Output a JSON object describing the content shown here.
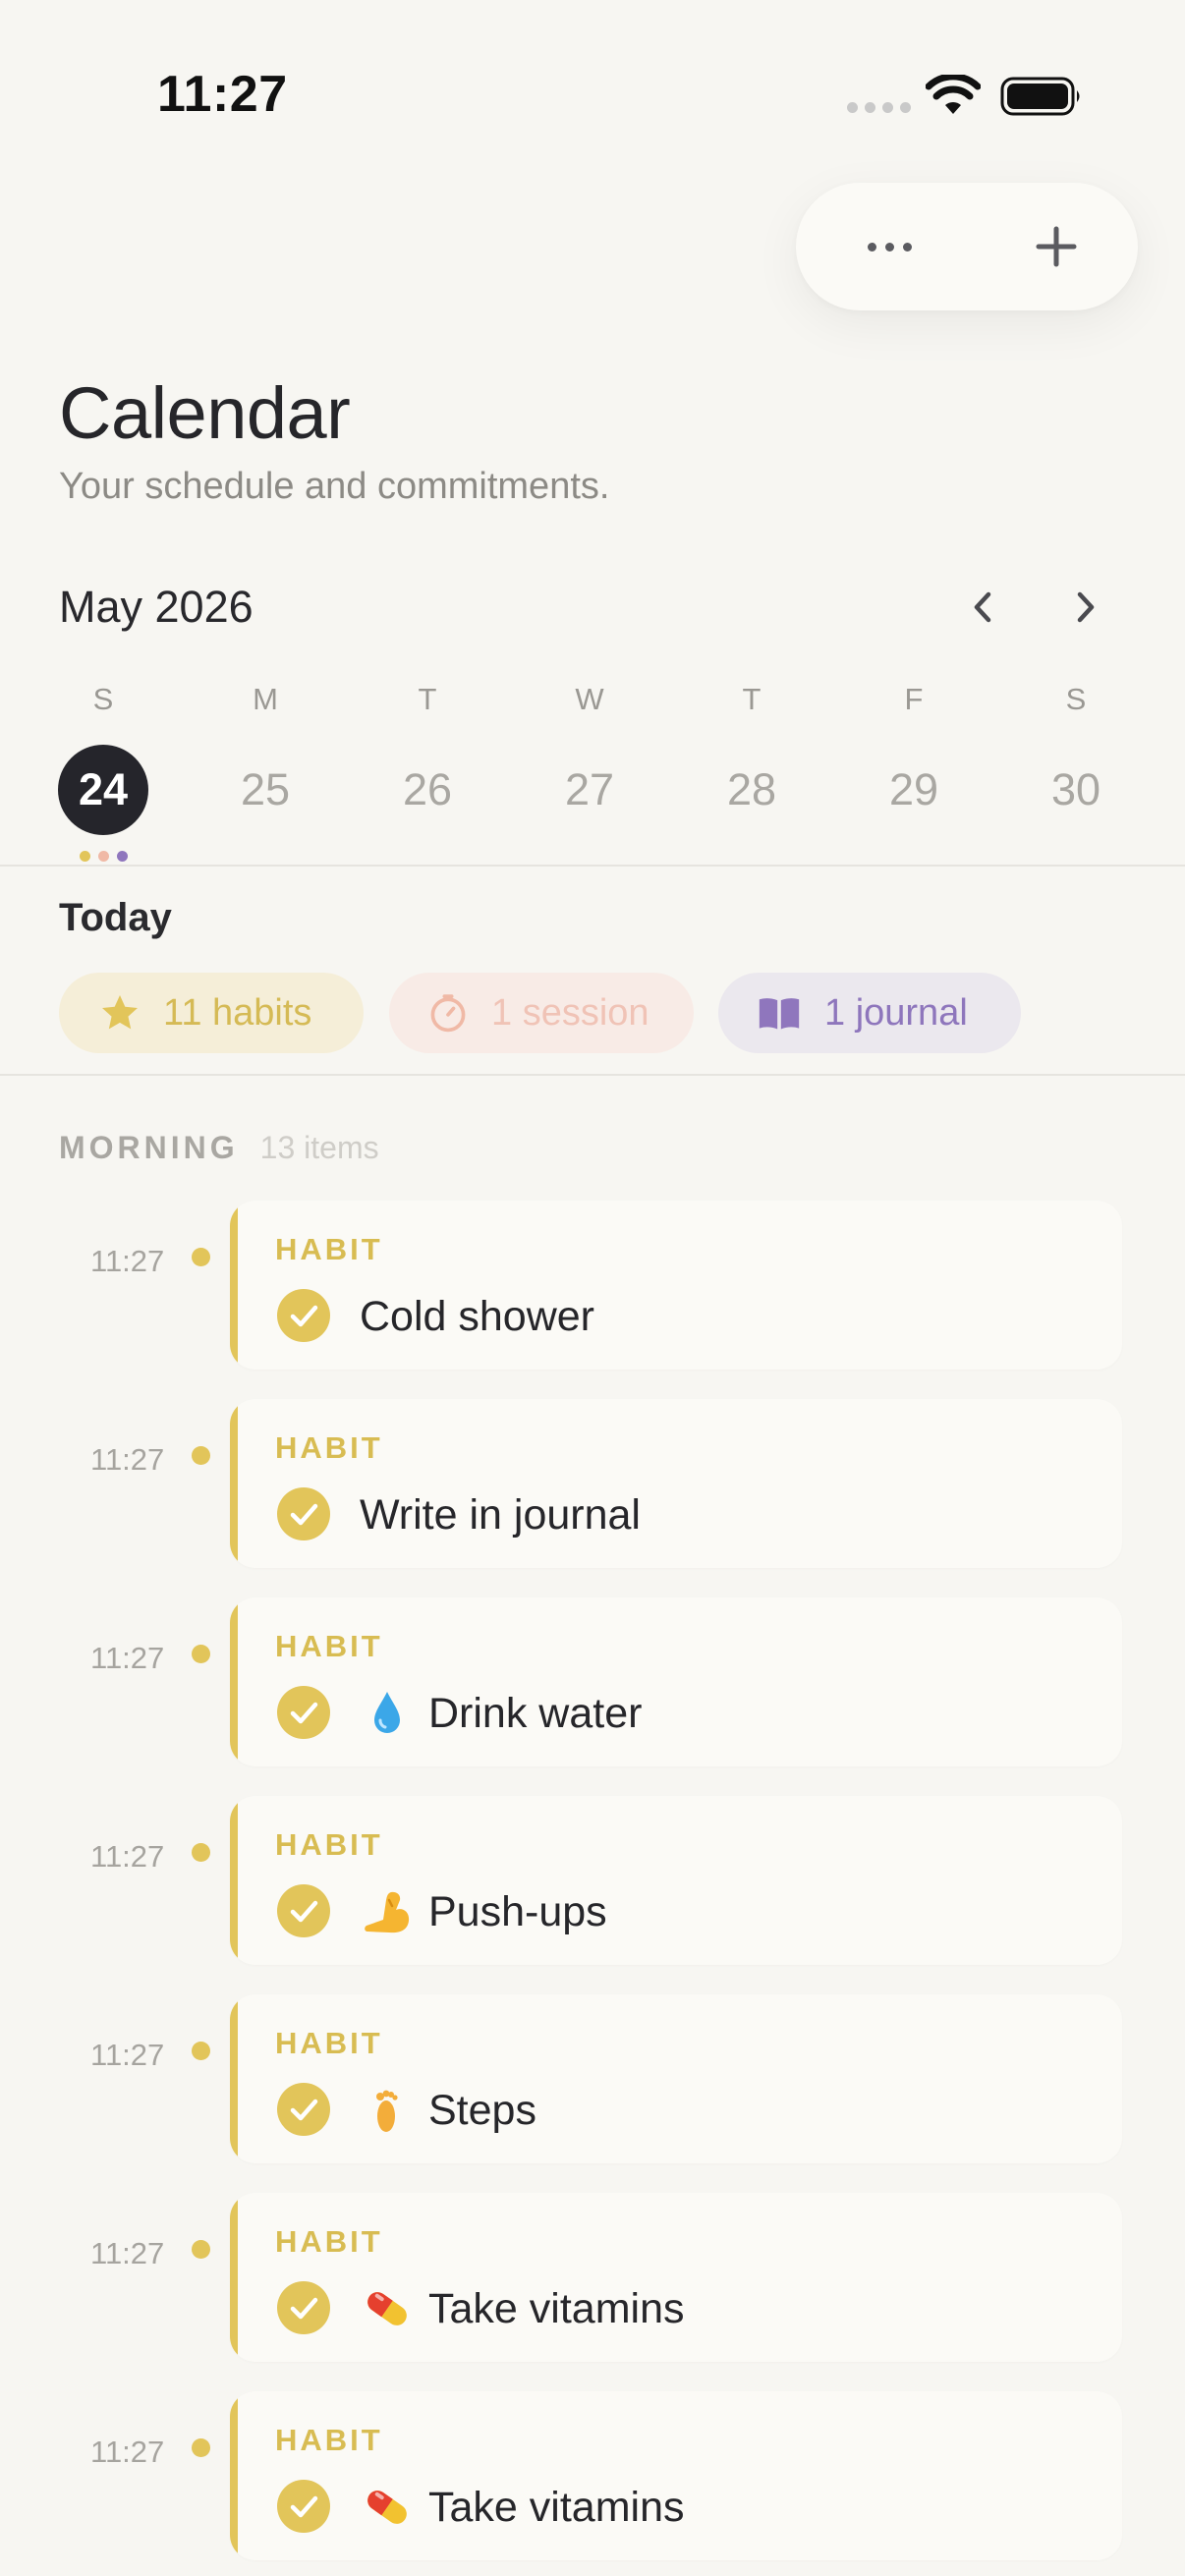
{
  "status_bar": {
    "time": "11:27"
  },
  "header": {
    "title": "Calendar",
    "subtitle": "Your schedule and commitments."
  },
  "calendar": {
    "month": "May 2026",
    "days": [
      {
        "letter": "S",
        "number": "24",
        "selected": true
      },
      {
        "letter": "M",
        "number": "25"
      },
      {
        "letter": "T",
        "number": "26"
      },
      {
        "letter": "W",
        "number": "27"
      },
      {
        "letter": "T",
        "number": "28"
      },
      {
        "letter": "F",
        "number": "29"
      },
      {
        "letter": "S",
        "number": "30"
      }
    ],
    "dot_colors": [
      "#e2c55a",
      "#f0b9a6",
      "#8f76bd"
    ]
  },
  "today": {
    "label": "Today",
    "chips": {
      "habits": "11 habits",
      "sessions": "1 session",
      "journal": "1 journal"
    }
  },
  "section": {
    "title": "MORNING",
    "count": "13 items"
  },
  "items": [
    {
      "time": "11:27",
      "type": "HABIT",
      "title": "Cold shower",
      "icon": ""
    },
    {
      "time": "11:27",
      "type": "HABIT",
      "title": "Write in journal",
      "icon": ""
    },
    {
      "time": "11:27",
      "type": "HABIT",
      "title": "Drink water",
      "icon": "water-drop-icon"
    },
    {
      "time": "11:27",
      "type": "HABIT",
      "title": "Push-ups",
      "icon": "flexed-bicep-icon"
    },
    {
      "time": "11:27",
      "type": "HABIT",
      "title": "Steps",
      "icon": "footprint-icon"
    },
    {
      "time": "11:27",
      "type": "HABIT",
      "title": "Take vitamins",
      "icon": "pill-icon"
    },
    {
      "time": "11:27",
      "type": "HABIT",
      "title": "Take vitamins",
      "icon": "pill-icon"
    }
  ],
  "colors": {
    "habit": "#e2c55a",
    "session": "#f0b9a6",
    "journal": "#8f76bd",
    "background": "#f7f6f2"
  }
}
